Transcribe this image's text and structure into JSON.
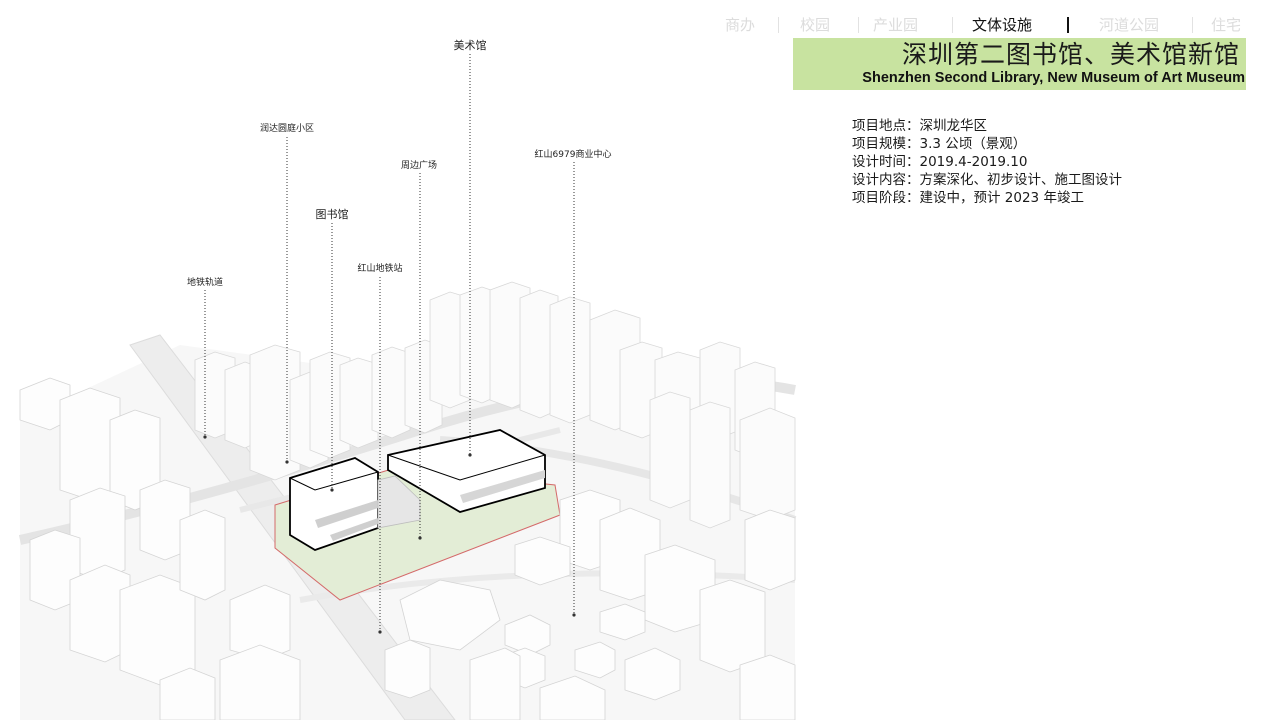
{
  "nav": {
    "items": [
      "商办",
      "校园",
      "产业园",
      "文体设施",
      "河道公园",
      "住宅"
    ],
    "active_index": 3
  },
  "banner": {
    "title_cn": "深圳第二图书馆、美术馆新馆",
    "title_en": "Shenzhen Second Library, New Museum of Art Museum",
    "color": "#c8e3a0"
  },
  "info": [
    "项目地点：深圳龙华区",
    "项目规模：3.3 公顷（景观）",
    "设计时间：2019.4-2019.10",
    "设计内容：方案深化、初步设计、施工图设计",
    "项目阶段：建设中，预计 2023 年竣工"
  ],
  "callouts": {
    "museum": "美术馆",
    "community": "润达圆庭小区",
    "plaza": "周边广场",
    "commercial": "红山6979商业中心",
    "library": "图书馆",
    "metro_station": "红山地铁站",
    "metro_track": "地铁轨道"
  }
}
